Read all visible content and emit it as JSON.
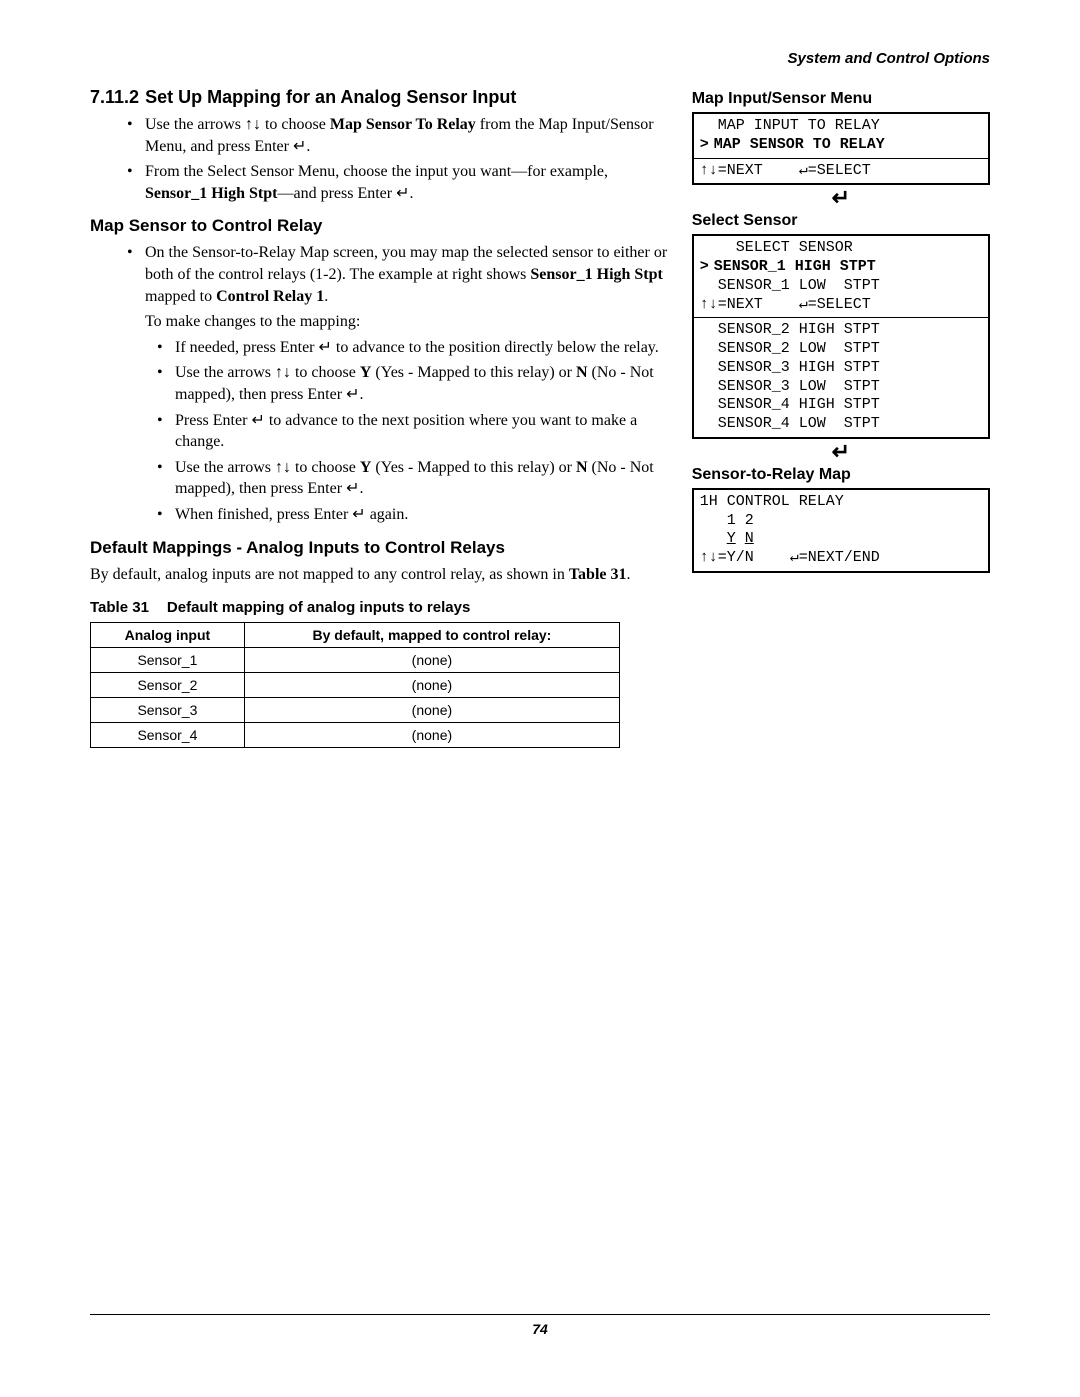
{
  "header": {
    "text": "System and Control Options"
  },
  "section": {
    "number": "7.11.2",
    "title": "Set Up Mapping for an Analog Sensor Input",
    "bullets": [
      "Use the arrows ↑↓ to choose Map Sensor To Relay from the Map Input/Sensor Menu, and press Enter ↵.",
      "From the Select Sensor Menu, choose the input you want—for example, Sensor_1 High Stpt—and press Enter ↵."
    ],
    "sub1": {
      "title": "Map Sensor to Control Relay",
      "intro_li": "On the Sensor-to-Relay Map screen, you may map the selected sensor to either or both of the control relays (1-2). The example at right shows Sensor_1 High Stpt mapped to Control Relay 1.",
      "intro2": "To make changes to the mapping:",
      "subbullets": [
        "If needed, press Enter ↵ to advance to the position directly below the relay.",
        "Use the arrows ↑↓ to choose Y (Yes - Mapped to this relay) or N (No - Not mapped), then press Enter ↵.",
        "Press Enter ↵ to advance to the next position where you want to make a change.",
        "Use the arrows ↑↓ to choose Y (Yes - Mapped to this relay) or N (No - Not mapped), then press Enter ↵.",
        "When finished, press Enter ↵ again."
      ]
    },
    "sub2": {
      "title": "Default Mappings - Analog Inputs to Control Relays",
      "para": "By default, analog inputs are not mapped to any control relay, as shown in Table 31."
    },
    "table": {
      "number": "Table 31",
      "caption": "Default mapping of analog inputs to relays",
      "headers": [
        "Analog input",
        "By default, mapped to control relay:"
      ],
      "rows": [
        [
          "Sensor_1",
          "(none)"
        ],
        [
          "Sensor_2",
          "(none)"
        ],
        [
          "Sensor_3",
          "(none)"
        ],
        [
          "Sensor_4",
          "(none)"
        ]
      ]
    }
  },
  "panels": {
    "p1": {
      "title": "Map Input/Sensor Menu",
      "line1": "  MAP INPUT TO RELAY",
      "selected": "MAP SENSOR TO RELAY",
      "nav": "↑↓=NEXT    ↵=SELECT"
    },
    "p2": {
      "title": "Select Sensor",
      "header_line": "    SELECT SENSOR",
      "selected": "SENSOR_1 HIGH STPT",
      "extra_top": "  SENSOR_1 LOW  STPT",
      "nav_top": "↑↓=NEXT    ↵=SELECT",
      "lines": [
        "  SENSOR_2 HIGH STPT",
        "  SENSOR_2 LOW  STPT",
        "  SENSOR_3 HIGH STPT",
        "  SENSOR_3 LOW  STPT",
        "  SENSOR_4 HIGH STPT",
        "  SENSOR_4 LOW  STPT"
      ]
    },
    "p3": {
      "title": "Sensor-to-Relay Map",
      "line1": "1H CONTROL RELAY",
      "line2": "   1 2",
      "line3": "   Y N",
      "nav": "↑↓=Y/N    ↵=NEXT/END"
    },
    "enter_arrow": "↵"
  },
  "footer": {
    "page": "74"
  }
}
